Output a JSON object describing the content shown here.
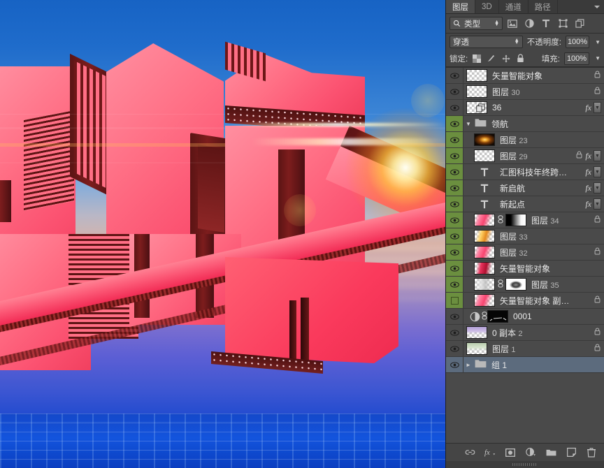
{
  "panel": {
    "tabs": [
      {
        "label": "图层",
        "active": true
      },
      {
        "label": "3D",
        "active": false
      },
      {
        "label": "通道",
        "active": false
      },
      {
        "label": "路径",
        "active": false
      }
    ],
    "menu_icon": "panel-menu-icon",
    "filter": {
      "search_icon": "search-icon",
      "kind_label": "类型",
      "buttons": [
        {
          "name": "filter-pixel-icon",
          "label": "像素图层滤镜"
        },
        {
          "name": "filter-adjustment-icon",
          "label": "调整图层滤镜"
        },
        {
          "name": "filter-type-icon",
          "label": "文字图层滤镜"
        },
        {
          "name": "filter-shape-icon",
          "label": "形状图层滤镜"
        },
        {
          "name": "filter-smartobject-icon",
          "label": "智能对象滤镜"
        }
      ]
    },
    "blend": {
      "mode": "穿透",
      "opacity_label": "不透明度:",
      "opacity_value": "100%"
    },
    "lock": {
      "label": "锁定:",
      "icons": [
        {
          "name": "lock-transparent-pixels-icon"
        },
        {
          "name": "lock-image-pixels-icon"
        },
        {
          "name": "lock-position-icon"
        },
        {
          "name": "lock-all-icon"
        }
      ],
      "fill_label": "填充:",
      "fill_value": "100%"
    },
    "bottom_buttons": [
      {
        "name": "link-layers-button",
        "label": "链接图层"
      },
      {
        "name": "layer-style-button",
        "label": "添加图层样式"
      },
      {
        "name": "layer-mask-button",
        "label": "添加图层蒙版"
      },
      {
        "name": "adjustment-layer-button",
        "label": "创建新的填充或调整图层"
      },
      {
        "name": "new-group-button",
        "label": "创建新组"
      },
      {
        "name": "new-layer-button",
        "label": "创建新图层"
      },
      {
        "name": "delete-layer-button",
        "label": "删除图层"
      }
    ]
  },
  "layers": [
    {
      "name": "矢量智能对象",
      "number": "",
      "type": "normal",
      "visible": true,
      "in_group": false,
      "indent": false,
      "selected": false,
      "locked": true,
      "fx": false,
      "thumb": "transparent"
    },
    {
      "name": "图层",
      "number": "30",
      "type": "normal",
      "visible": true,
      "in_group": false,
      "indent": false,
      "selected": false,
      "locked": true,
      "fx": false,
      "thumb": "transparent"
    },
    {
      "name": "36",
      "number": "",
      "type": "smartobject",
      "visible": true,
      "in_group": false,
      "indent": false,
      "selected": false,
      "locked": false,
      "fx": true,
      "thumb": "smart"
    },
    {
      "name": "领航",
      "number": "",
      "type": "group-open",
      "visible": true,
      "in_group": true,
      "indent": false,
      "selected": false,
      "locked": false,
      "fx": false,
      "thumb": "folder"
    },
    {
      "name": "图层",
      "number": "23",
      "type": "normal",
      "visible": true,
      "in_group": true,
      "indent": true,
      "selected": false,
      "locked": false,
      "fx": false,
      "thumb": "flare"
    },
    {
      "name": "图层",
      "number": "29",
      "type": "normal",
      "visible": true,
      "in_group": true,
      "indent": true,
      "selected": false,
      "locked": true,
      "fx": true,
      "thumb": "transparent"
    },
    {
      "name": "汇图科技年终跨…",
      "number": "",
      "type": "text",
      "visible": true,
      "in_group": true,
      "indent": true,
      "selected": false,
      "locked": false,
      "fx": true,
      "thumb": "text"
    },
    {
      "name": "新启航",
      "number": "",
      "type": "text",
      "visible": true,
      "in_group": true,
      "indent": true,
      "selected": false,
      "locked": false,
      "fx": true,
      "thumb": "text"
    },
    {
      "name": "新起点",
      "number": "",
      "type": "text",
      "visible": true,
      "in_group": true,
      "indent": true,
      "selected": false,
      "locked": false,
      "fx": true,
      "thumb": "text"
    },
    {
      "name": "图层",
      "number": "34",
      "type": "masked",
      "visible": true,
      "in_group": true,
      "indent": true,
      "selected": false,
      "locked": true,
      "fx": false,
      "thumb": "pinkart",
      "mask": "gradient"
    },
    {
      "name": "图层",
      "number": "33",
      "type": "normal",
      "visible": true,
      "in_group": true,
      "indent": true,
      "selected": false,
      "locked": false,
      "fx": false,
      "thumb": "goldart"
    },
    {
      "name": "图层",
      "number": "32",
      "type": "normal",
      "visible": true,
      "in_group": true,
      "indent": true,
      "selected": false,
      "locked": true,
      "fx": false,
      "thumb": "pinkart"
    },
    {
      "name": "矢量智能对象",
      "number": "",
      "type": "normal",
      "visible": true,
      "in_group": true,
      "indent": true,
      "selected": false,
      "locked": false,
      "fx": false,
      "thumb": "redart"
    },
    {
      "name": "图层",
      "number": "35",
      "type": "masked",
      "visible": true,
      "in_group": true,
      "indent": true,
      "selected": false,
      "locked": false,
      "fx": false,
      "thumb": "lightart",
      "mask": "whiteblur"
    },
    {
      "name": "矢量智能对象 副…",
      "number": "",
      "type": "normal",
      "visible": false,
      "in_group": true,
      "indent": true,
      "selected": false,
      "locked": true,
      "fx": false,
      "thumb": "pinkart"
    },
    {
      "name": "0001",
      "number": "",
      "type": "adjustment",
      "visible": true,
      "in_group": false,
      "indent": false,
      "selected": false,
      "locked": false,
      "fx": false,
      "thumb": "adjust",
      "mask": "blackmask"
    },
    {
      "name": "0 副本",
      "number": "2",
      "type": "normal",
      "visible": true,
      "in_group": false,
      "indent": false,
      "selected": false,
      "locked": true,
      "fx": false,
      "thumb": "purple"
    },
    {
      "name": "图层",
      "number": "1",
      "type": "normal",
      "visible": true,
      "in_group": false,
      "indent": false,
      "selected": false,
      "locked": true,
      "fx": false,
      "thumb": "greenish"
    },
    {
      "name": "组 1",
      "number": "",
      "type": "group-closed",
      "visible": true,
      "in_group": false,
      "indent": false,
      "selected": true,
      "locked": false,
      "fx": false,
      "thumb": "folder"
    }
  ],
  "canvas": {
    "description": "3D 立体粉红色中文字效果，蓝色天空渐变背景，带太阳镜头光晕",
    "accent_pink": "#fb5170",
    "accent_blue": "#1763c4",
    "sun_color": "#ffd24a"
  }
}
